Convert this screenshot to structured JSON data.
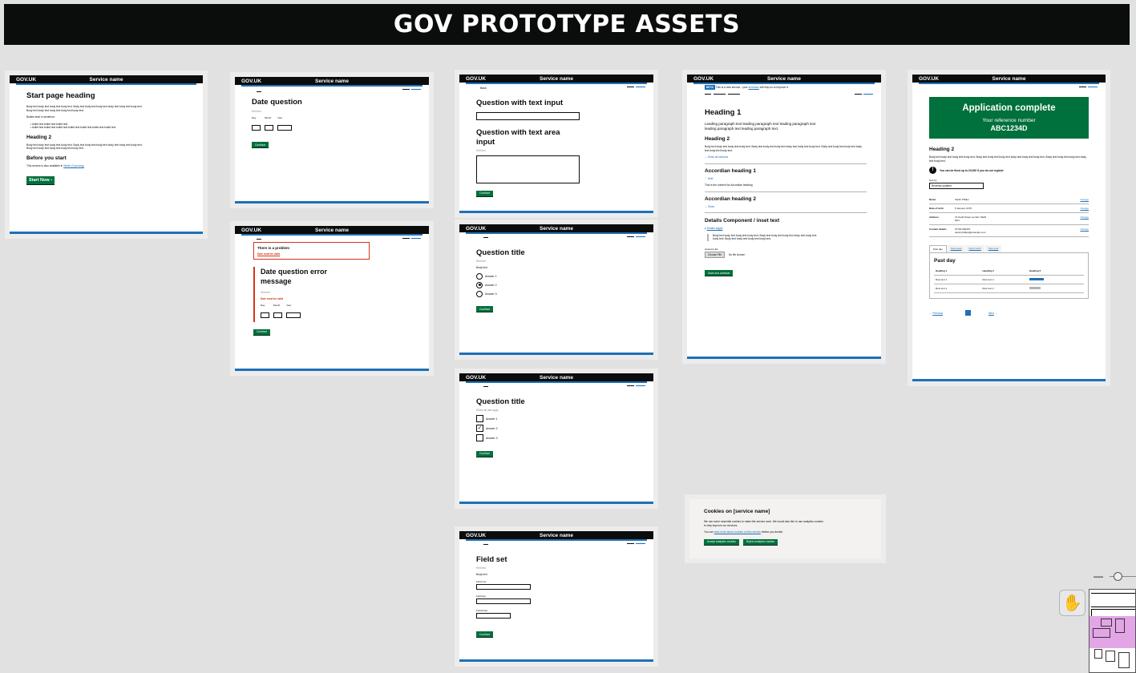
{
  "title": "GOV PROTOTYPE ASSETS",
  "header": {
    "logo": "GOV.UK",
    "service": "Service name"
  },
  "start_page": {
    "heading": "Start page heading",
    "body": "Body text body text body text body text. Body text body text body text body text body text body text. Body text body text body text body text body text.",
    "bullets_intro": "Bullets lead in sentence:",
    "bullets": [
      "bullet text bullet text bullet text",
      "bullet text bullet text bullet text bullet text bullet text bullet text bullet text"
    ],
    "heading2": "Heading 2",
    "body2": "Body text body text body text body text. Body text body text body text body text body text body text. Body text body text body text body text body text.",
    "before": "Before you start",
    "welsh_prefix": "This service is also available in",
    "welsh_link": "Welsh (Cymraeg)",
    "button": "Start Now"
  },
  "date_question": {
    "heading": "Date question",
    "hint": "Hint text",
    "day": "Day",
    "month": "Month",
    "year": "Year",
    "button": "Continue"
  },
  "date_error": {
    "summary_title": "There is a problem",
    "summary_link": "Date must be valid",
    "heading": "Date question error message",
    "hint": "Hint text",
    "error": "Date must be valid",
    "day": "Day",
    "month": "Month",
    "year": "Year",
    "button": "Continue"
  },
  "text_input": {
    "back": "Back",
    "heading1": "Question with text input",
    "heading2": "Question with text area input",
    "hint": "Hint text",
    "button": "Continue"
  },
  "radios": {
    "heading": "Question title",
    "hint": "Hint text",
    "body": "Body text",
    "options": [
      "Answer 1",
      "Answer 2",
      "Answer 3"
    ],
    "button": "Continue"
  },
  "checkboxes": {
    "heading": "Question title",
    "hint": "Select all that apply",
    "options": [
      "Answer 1",
      "Answer 2",
      "Answer 3"
    ],
    "button": "Continue"
  },
  "fieldset": {
    "heading": "Field set",
    "hint": "Hint text",
    "body": "Body text",
    "fields": [
      "Field one",
      "Field two",
      "Field three"
    ],
    "button": "Continue"
  },
  "content_page": {
    "beta_tag": "BETA",
    "beta_prefix": "This is a new service - your",
    "beta_link": "feedback",
    "beta_suffix": "will help us to improve it.",
    "heading": "Heading 1",
    "lead": "Leading paragraph text leading paragraph text leading paragraph text leading paragraph text leading paragraph text.",
    "heading2": "Heading 2",
    "body": "Body text body text body text body text. Body text body text body text body text body text body text. Body text body text body text body text body text body text.",
    "show_all": "Show all sections",
    "acc1": "Accordian heading 1",
    "hide": "Hide",
    "acc1_content": "This is the content for Accordian heading",
    "acc2": "Accordian heading 2",
    "show": "Show",
    "details_heading": "Details Component / inset text",
    "details_toggle": "Details toggle",
    "inset": "Body text body text body text body text. Body text body text body text body text body text body text. Body text body text body text body text.",
    "upload_label": "Upload a file",
    "choose": "Choose File",
    "no_file": "No file chosen",
    "save": "Save and continue"
  },
  "complete_page": {
    "panel_title": "Application complete",
    "ref_label": "Your reference number",
    "ref": "ABC1234D",
    "heading2": "Heading 2",
    "body": "Body text body text body text body text. Body text body text body text body text body text body text. Body text body text body text body text body text.",
    "warning": "You can be fined up to £5,000 if you do not register",
    "sort_label": "Sort by",
    "sort_value": "Recently updated",
    "summary": [
      {
        "key": "Name",
        "value": "Sarah Philips",
        "action": "Change"
      },
      {
        "key": "Date of birth",
        "value": "5 January 1978",
        "action": "Change"
      },
      {
        "key": "Address",
        "value": "72 Guild Street London SE23 6FH",
        "action": "Change"
      },
      {
        "key": "Contact details",
        "value": "07700 900457 sarah.phillips@example.com",
        "action": "Change"
      }
    ],
    "tabs": [
      "Past day",
      "Past week",
      "Past month",
      "Past year"
    ],
    "tab_heading": "Past day",
    "table_headers": [
      "Heading 1",
      "Heading 2",
      "Heading 3"
    ],
    "table_rows": [
      [
        "Row text 1",
        "Row text 2"
      ],
      [
        "Row text 1",
        "Row text 2"
      ]
    ],
    "prev": "Previous",
    "next": "Next"
  },
  "cookies": {
    "heading": "Cookies on [service name]",
    "body1": "We use some essential cookies to make this service work. We would also like to use analytics cookies to help improve our services.",
    "body2_prefix": "You can",
    "body2_link": "read more about cookies on this service",
    "body2_suffix": "before you decide.",
    "accept": "Accept analytics cookies",
    "reject": "Reject analytics cookies"
  },
  "toolbar": {
    "hand_icon": "hand-icon",
    "minus": "—"
  }
}
